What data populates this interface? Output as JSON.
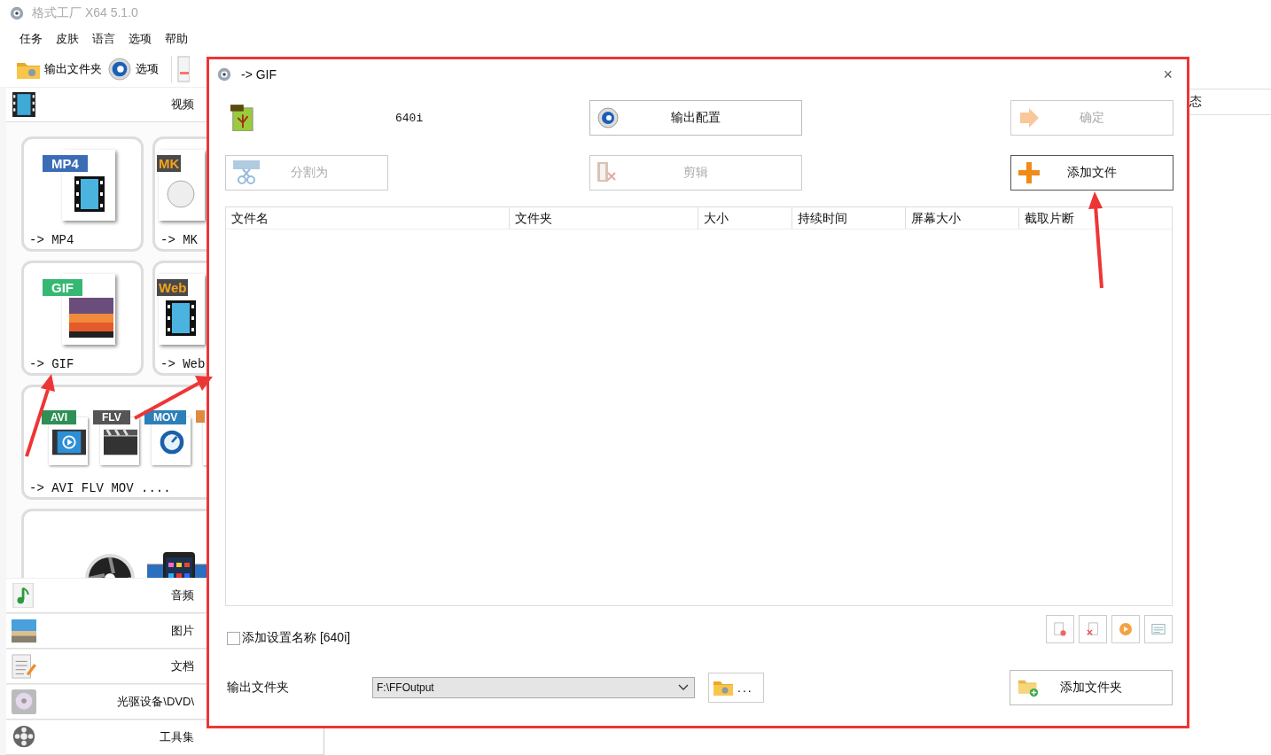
{
  "app": {
    "title": "格式工厂 X64 5.1.0",
    "menu": [
      "任务",
      "皮肤",
      "语言",
      "选项",
      "帮助"
    ],
    "toolbar": [
      {
        "label": "输出文件夹",
        "kind": "folder"
      },
      {
        "label": "选项",
        "kind": "gear"
      }
    ],
    "video_category": {
      "label": "视频"
    },
    "video_tiles": [
      {
        "kind": "single",
        "badge": "MP4",
        "color": "#3b6db6",
        "label": "-> MP4"
      },
      {
        "kind": "single",
        "badge": "MK",
        "color": "#4a4a4a",
        "label": "-> MK"
      },
      {
        "kind": "single",
        "badge": "GIF",
        "color": "#35b873",
        "label": "-> GIF"
      },
      {
        "kind": "single",
        "badge": "Web",
        "color": "#4a4a4a",
        "label": "-> Web"
      },
      {
        "kind": "multi",
        "label": "-> AVI FLV MOV ....",
        "badges": [
          {
            "badge": "AVI",
            "color": "#2f8f55"
          },
          {
            "badge": "FLV",
            "color": "#555555"
          },
          {
            "badge": "MOV",
            "color": "#2c7fb8"
          }
        ]
      },
      {
        "kind": "devices"
      }
    ],
    "categories": [
      {
        "label": "音频",
        "kind": "audio"
      },
      {
        "label": "图片",
        "kind": "image"
      },
      {
        "label": "文档",
        "kind": "doc"
      },
      {
        "label": "光驱设备\\DVD\\",
        "kind": "disc"
      },
      {
        "label": "工具集",
        "kind": "tools"
      }
    ],
    "list_header": "态"
  },
  "dialog": {
    "title": "-> GIF",
    "close": "×",
    "preset": "640i",
    "buttons": [
      {
        "label": "输出配置",
        "kind": "gear",
        "disabled": false
      },
      {
        "label": "确定",
        "kind": "arrow",
        "disabled": true
      },
      {
        "label": "分割为",
        "kind": "split",
        "disabled": true
      },
      {
        "label": "剪辑",
        "kind": "clip",
        "disabled": true
      },
      {
        "label": "添加文件",
        "kind": "plus",
        "disabled": false
      }
    ],
    "table": {
      "columns": [
        "文件名",
        "文件夹",
        "大小",
        "持续时间",
        "屏幕大小",
        "截取片断"
      ]
    },
    "tools": [
      {
        "kind": "remove"
      },
      {
        "kind": "delete"
      },
      {
        "kind": "play"
      },
      {
        "kind": "list"
      }
    ],
    "add_name": {
      "label": "添加设置名称 [640i]",
      "checked": false
    },
    "output": {
      "label": "输出文件夹",
      "value": "F:\\FFOutput",
      "browse": "...",
      "add_folder": "添加文件夹"
    }
  }
}
